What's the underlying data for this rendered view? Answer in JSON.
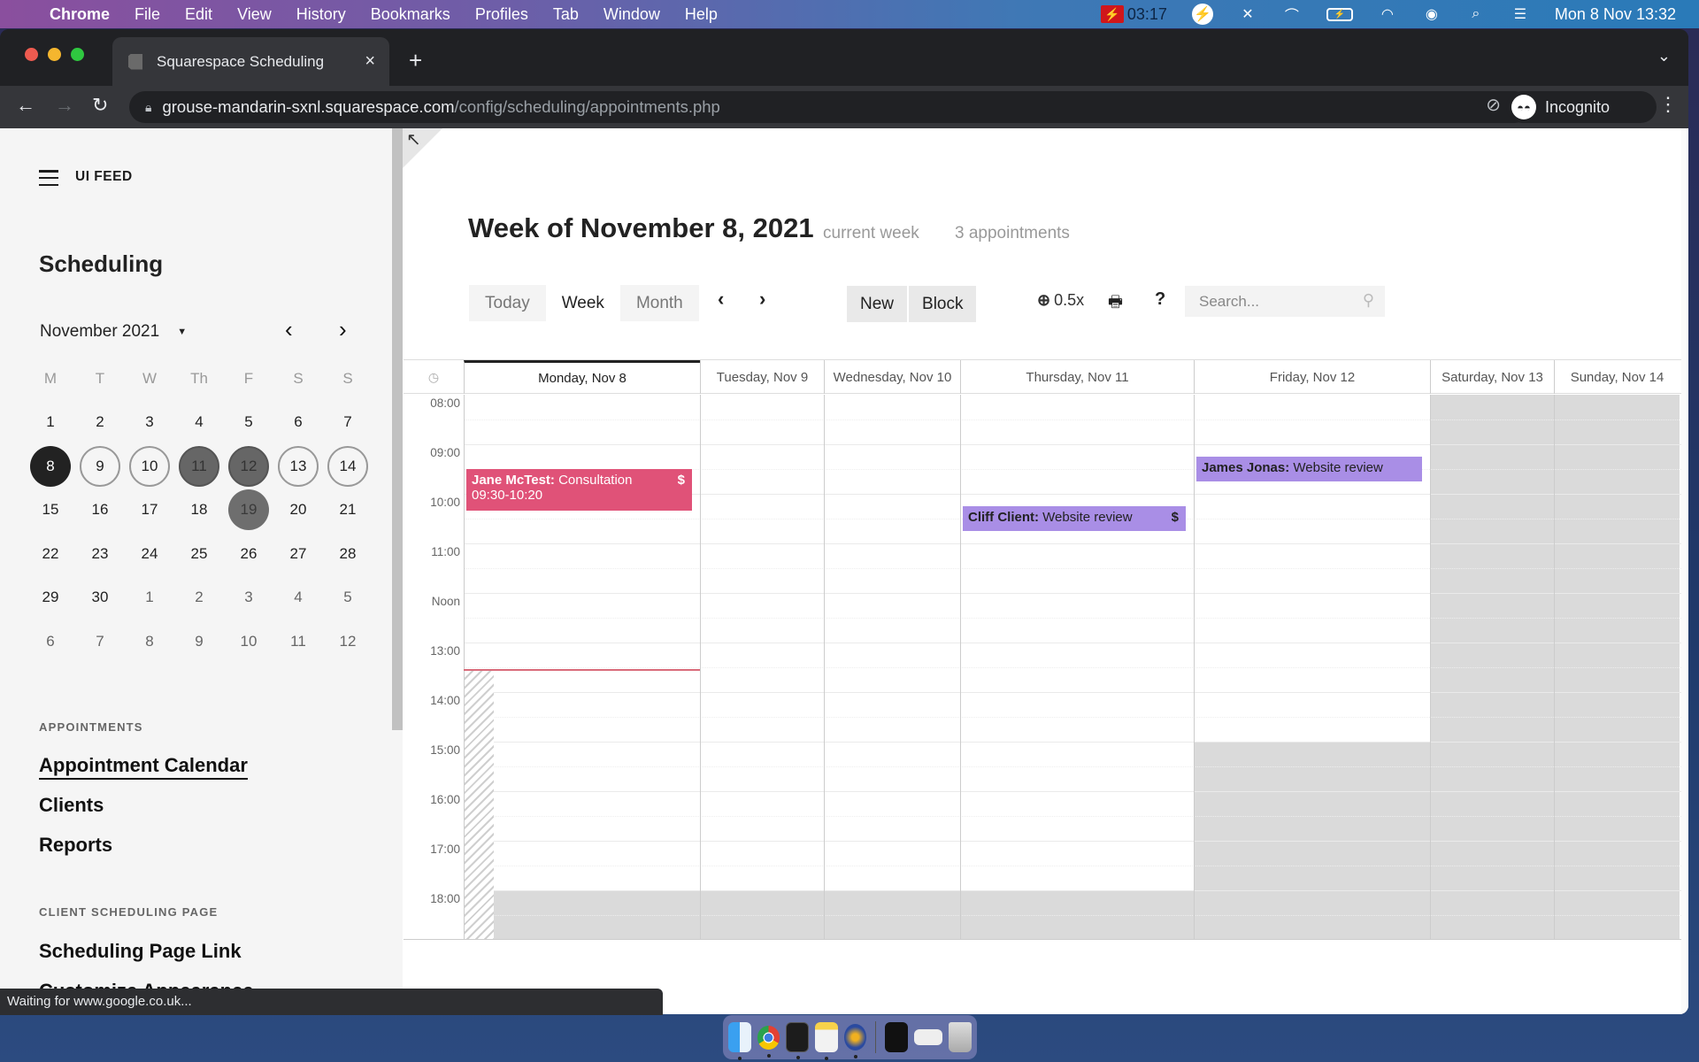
{
  "menubar": {
    "app_name": "Chrome",
    "menus": [
      "File",
      "Edit",
      "View",
      "History",
      "Bookmarks",
      "Profiles",
      "Tab",
      "Window",
      "Help"
    ],
    "recording_timer": "03:17",
    "datetime": "Mon 8 Nov  13:32"
  },
  "browser": {
    "tab_title": "Squarespace Scheduling",
    "url_host": "grouse-mandarin-sxnl.squarespace.com",
    "url_path": "/config/scheduling/appointments.php",
    "profile_label": "Incognito",
    "status_text": "Waiting for www.google.co.uk..."
  },
  "sidebar": {
    "site_label": "UI FEED",
    "title": "Scheduling",
    "mini_calendar": {
      "month_label": "November 2021",
      "weekdays": [
        "M",
        "T",
        "W",
        "Th",
        "F",
        "S",
        "S"
      ],
      "weeks": [
        [
          {
            "d": "1"
          },
          {
            "d": "2"
          },
          {
            "d": "3"
          },
          {
            "d": "4"
          },
          {
            "d": "5"
          },
          {
            "d": "6"
          },
          {
            "d": "7"
          }
        ],
        [
          {
            "d": "8",
            "state": "today"
          },
          {
            "d": "9",
            "state": "ring"
          },
          {
            "d": "10",
            "state": "ring"
          },
          {
            "d": "11",
            "state": "busy"
          },
          {
            "d": "12",
            "state": "busy"
          },
          {
            "d": "13",
            "state": "ring"
          },
          {
            "d": "14",
            "state": "ring"
          }
        ],
        [
          {
            "d": "15"
          },
          {
            "d": "16"
          },
          {
            "d": "17"
          },
          {
            "d": "18"
          },
          {
            "d": "19",
            "state": "booked"
          },
          {
            "d": "20"
          },
          {
            "d": "21"
          }
        ],
        [
          {
            "d": "22"
          },
          {
            "d": "23"
          },
          {
            "d": "24"
          },
          {
            "d": "25"
          },
          {
            "d": "26"
          },
          {
            "d": "27"
          },
          {
            "d": "28"
          }
        ],
        [
          {
            "d": "29"
          },
          {
            "d": "30"
          },
          {
            "d": "1",
            "state": "other"
          },
          {
            "d": "2",
            "state": "other"
          },
          {
            "d": "3",
            "state": "other"
          },
          {
            "d": "4",
            "state": "other"
          },
          {
            "d": "5",
            "state": "other"
          }
        ],
        [
          {
            "d": "6",
            "state": "other"
          },
          {
            "d": "7",
            "state": "other"
          },
          {
            "d": "8",
            "state": "other"
          },
          {
            "d": "9",
            "state": "other"
          },
          {
            "d": "10",
            "state": "other"
          },
          {
            "d": "11",
            "state": "other"
          },
          {
            "d": "12",
            "state": "other"
          }
        ]
      ]
    },
    "sections": {
      "appointments_heading": "APPOINTMENTS",
      "appointment_calendar": "Appointment Calendar",
      "clients": "Clients",
      "reports": "Reports",
      "client_page_heading": "CLIENT SCHEDULING PAGE",
      "scheduling_page_link": "Scheduling Page Link",
      "customize_appearance": "Customize Appearance"
    }
  },
  "main": {
    "week_title": "Week of November 8, 2021",
    "current_week_label": "current week",
    "appointment_count": "3 appointments",
    "view_tabs": [
      {
        "label": "Today",
        "active": false
      },
      {
        "label": "Week",
        "active": true
      },
      {
        "label": "Month",
        "active": false
      }
    ],
    "new_label": "New",
    "block_label": "Block",
    "zoom_level": "0.5x",
    "search_placeholder": "Search...",
    "days": [
      {
        "label": "Monday, Nov 8",
        "current": true
      },
      {
        "label": "Tuesday, Nov 9"
      },
      {
        "label": "Wednesday, Nov 10"
      },
      {
        "label": "Thursday, Nov 11"
      },
      {
        "label": "Friday, Nov 12"
      },
      {
        "label": "Saturday, Nov 13"
      },
      {
        "label": "Sunday, Nov 14"
      }
    ],
    "hours": [
      "08:00",
      "09:00",
      "10:00",
      "11:00",
      "Noon",
      "13:00",
      "14:00",
      "15:00",
      "16:00",
      "17:00",
      "18:00"
    ],
    "day_start_hour": 8,
    "day_end_hour": 19,
    "current_time": "13:32",
    "appointments": [
      {
        "day": 0,
        "client": "Jane McTest:",
        "service": "Consultation",
        "time": "09:30-10:20",
        "start": 9.5,
        "end": 10.333,
        "paid_icon": "$",
        "color": "#e05278"
      },
      {
        "day": 3,
        "client": "Cliff Client:",
        "service": "Website review",
        "time": "",
        "start": 10.25,
        "end": 10.75,
        "paid_icon": "$",
        "color": "#a98ee6"
      },
      {
        "day": 4,
        "client": "James Jonas:",
        "service": "Website review",
        "time": "",
        "start": 9.25,
        "end": 9.75,
        "paid_icon": "",
        "color": "#a98ee6"
      }
    ]
  }
}
